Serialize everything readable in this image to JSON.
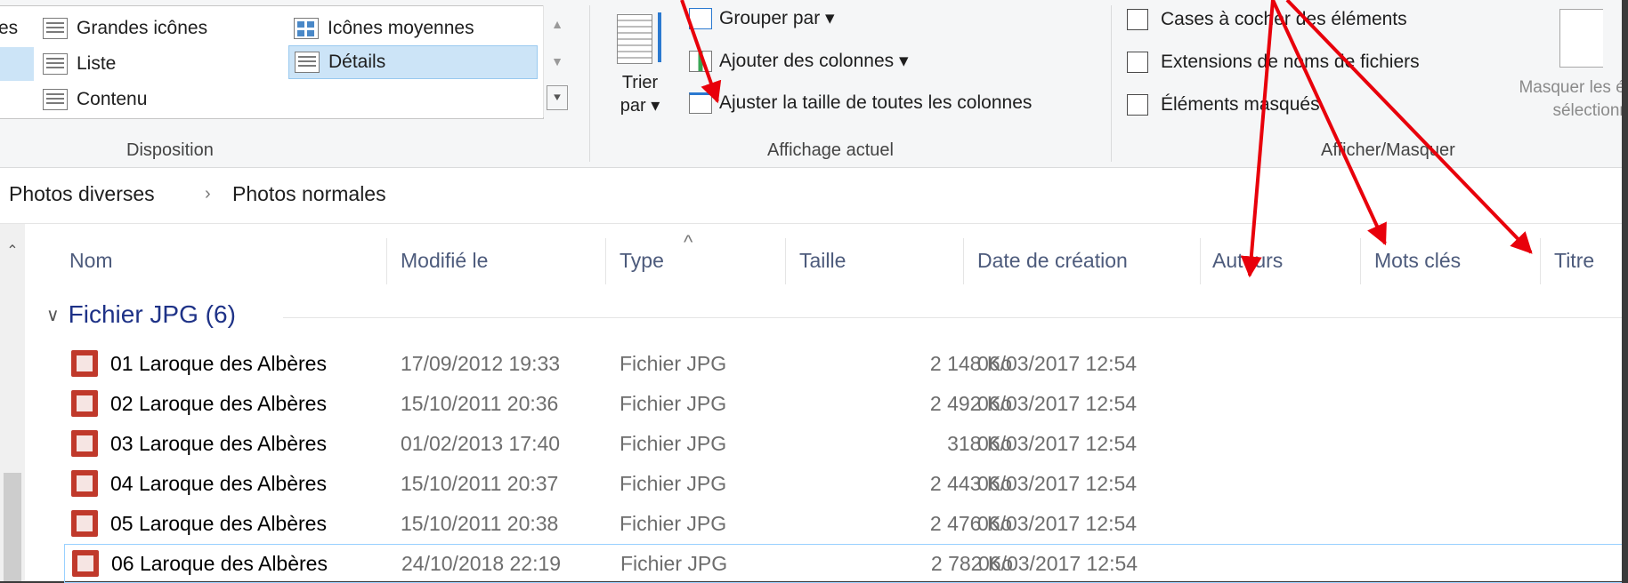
{
  "ribbon": {
    "layout": {
      "items": [
        {
          "label": "es"
        },
        {
          "label": "Grandes icônes"
        },
        {
          "label": "Icônes moyennes"
        },
        {
          "label": "Liste"
        },
        {
          "label": "Détails"
        },
        {
          "label": "Contenu"
        }
      ],
      "group_label": "Disposition"
    },
    "current_view": {
      "sort_label_1": "Trier",
      "sort_label_2": "par ▾",
      "group_by": "Grouper par ▾",
      "add_columns": "Ajouter des colonnes ▾",
      "fit_columns": "Ajuster la taille de toutes les colonnes",
      "group_label": "Affichage actuel"
    },
    "show_hide": {
      "checkboxes": [
        {
          "label": "Cases à cocher des éléments",
          "checked": false
        },
        {
          "label": "Extensions de noms de fichiers",
          "checked": false
        },
        {
          "label": "Éléments masqués",
          "checked": false
        }
      ],
      "hide_selected_1": "Masquer les él",
      "hide_selected_2": "sélectionn",
      "group_label": "Afficher/Masquer"
    }
  },
  "breadcrumb": {
    "items": [
      "Photos diverses",
      "›",
      "Photos normales"
    ]
  },
  "columns": [
    "Nom",
    "Modifié le",
    "Type",
    "Taille",
    "Date de création",
    "Auteurs",
    "Mots clés",
    "Titre"
  ],
  "sort_indicator": "^",
  "group": {
    "chevron": "∨",
    "label": "Fichier JPG (6)"
  },
  "files": [
    {
      "name": "01 Laroque des Albères",
      "modified": "17/09/2012 19:33",
      "type": "Fichier JPG",
      "size": "2 148 Ko",
      "created": "06/03/2017 12:54"
    },
    {
      "name": "02 Laroque des Albères",
      "modified": "15/10/2011 20:36",
      "type": "Fichier JPG",
      "size": "2 492 Ko",
      "created": "06/03/2017 12:54"
    },
    {
      "name": "03 Laroque des Albères",
      "modified": "01/02/2013 17:40",
      "type": "Fichier JPG",
      "size": "318 Ko",
      "created": "06/03/2017 12:54"
    },
    {
      "name": "04 Laroque des Albères",
      "modified": "15/10/2011 20:37",
      "type": "Fichier JPG",
      "size": "2 443 Ko",
      "created": "06/03/2017 12:54"
    },
    {
      "name": "05 Laroque des Albères",
      "modified": "15/10/2011 20:38",
      "type": "Fichier JPG",
      "size": "2 476 Ko",
      "created": "06/03/2017 12:54"
    },
    {
      "name": "06 Laroque des Albères",
      "modified": "24/10/2018 22:19",
      "type": "Fichier JPG",
      "size": "2 782 Ko",
      "created": "06/03/2017 12:54"
    }
  ],
  "annotation_color": "#e8000b"
}
